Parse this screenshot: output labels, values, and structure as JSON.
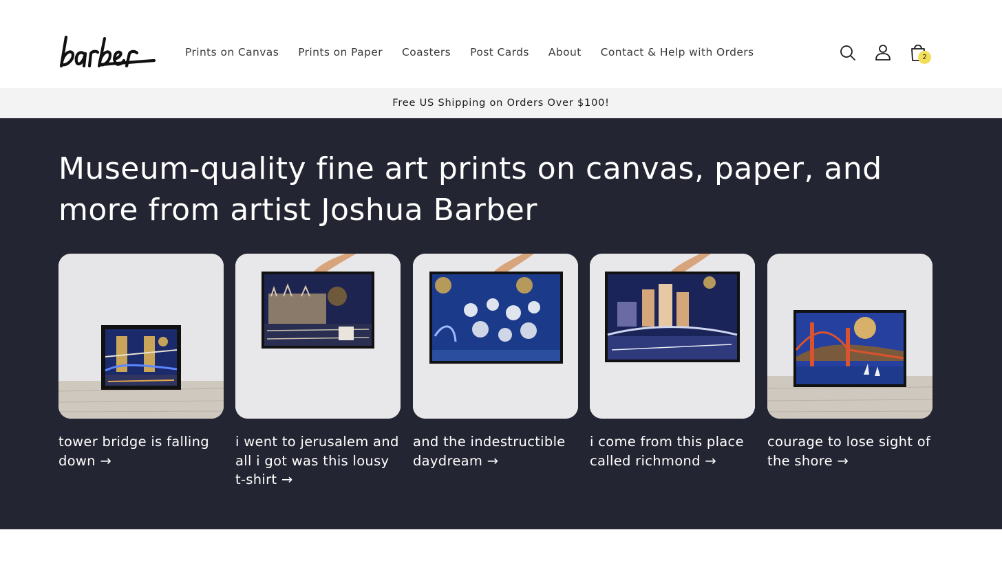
{
  "header": {
    "logo_text": "barber",
    "nav": [
      {
        "label": "Prints on Canvas"
      },
      {
        "label": "Prints on Paper"
      },
      {
        "label": "Coasters"
      },
      {
        "label": "Post Cards"
      },
      {
        "label": "About"
      },
      {
        "label": "Contact & Help with Orders"
      }
    ],
    "icons": [
      "search-icon",
      "account-icon",
      "cart-icon"
    ],
    "cart_count": "2"
  },
  "announcement": {
    "text": "Free US Shipping on Orders Over $100!"
  },
  "hero": {
    "heading": "Museum-quality fine art prints on canvas, paper, and more from artist Joshua Barber",
    "products": [
      {
        "title": "tower bridge is falling down →"
      },
      {
        "title": "i went to jerusalem and all i got was this lousy t-shirt →"
      },
      {
        "title": "and the indestructible daydream →"
      },
      {
        "title": "i come from this place called richmond →"
      },
      {
        "title": "courage to lose sight of the shore →"
      }
    ]
  },
  "colors": {
    "hero_bg": "#242532",
    "announce_bg": "#f3f3f3",
    "badge": "#f3de5a"
  }
}
